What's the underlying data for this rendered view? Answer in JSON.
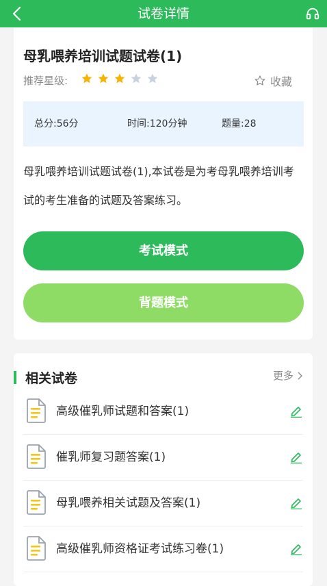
{
  "header": {
    "title": "试卷详情"
  },
  "paper": {
    "title": "母乳喂养培训试题试卷(1)",
    "rating_label": "推荐星级:",
    "rating": 3,
    "rating_max": 5,
    "favorite_label": "收藏",
    "total_score": "总分:56分",
    "duration": "时间:120分钟",
    "question_count": "题量:28",
    "description": "母乳喂养培训试题试卷(1),本试卷是为考母乳喂养培训考试的考生准备的试题及答案练习。",
    "exam_mode_label": "考试模式",
    "study_mode_label": "背题模式"
  },
  "related": {
    "title": "相关试卷",
    "more_label": "更多",
    "items": [
      {
        "label": "高级催乳师试题和答案(1)"
      },
      {
        "label": "催乳师复习题答案(1)"
      },
      {
        "label": "母乳喂养相关试题及答案(1)"
      },
      {
        "label": "高级催乳师资格证考试练习卷(1)"
      }
    ]
  },
  "colors": {
    "brand_green": "#2dba5a",
    "light_green": "#8edc65",
    "star_active": "#f5b400",
    "star_inactive": "#c9d3e0",
    "doc_icon": "#f5c518"
  },
  "icons": {
    "back": "chevron-left-icon",
    "support": "headset-icon",
    "favorite": "star-outline-icon",
    "document": "document-icon",
    "edit": "pencil-icon"
  }
}
